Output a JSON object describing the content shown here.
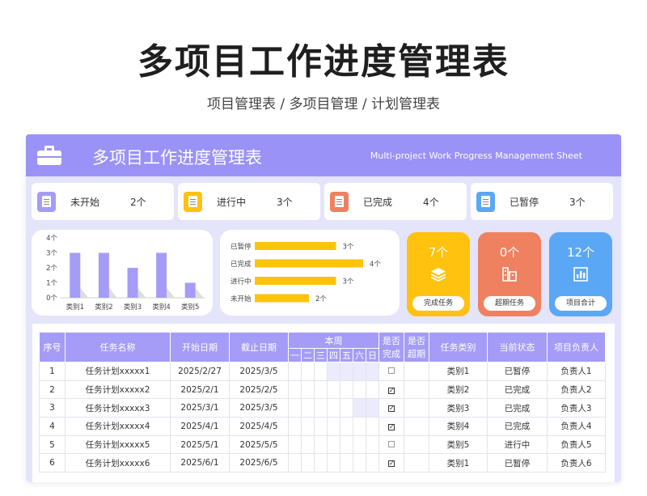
{
  "page": {
    "title": "多项目工作进度管理表",
    "subtitle": "项目管理表 / 多项目管理 / 计划管理表"
  },
  "sheet": {
    "title": "多项目工作进度管理表",
    "subtitle": "Multi-project Work Progress Management Sheet"
  },
  "stats": [
    {
      "label": "未开始",
      "count": "2个",
      "color": "#a49cf7"
    },
    {
      "label": "进行中",
      "count": "3个",
      "color": "#ffc20e"
    },
    {
      "label": "已完成",
      "count": "4个",
      "color": "#ef8160"
    },
    {
      "label": "已暂停",
      "count": "3个",
      "color": "#5aa7f5"
    }
  ],
  "chart_data": [
    {
      "type": "bar",
      "categories": [
        "类别1",
        "类别2",
        "类别3",
        "类别4",
        "类别5"
      ],
      "values": [
        3,
        3,
        2,
        3,
        1
      ],
      "ylim": [
        0,
        4
      ],
      "yticks": [
        "0个",
        "1个",
        "2个",
        "3个",
        "4个"
      ],
      "color": "#a49cf7"
    },
    {
      "type": "bar",
      "orientation": "horizontal",
      "categories": [
        "已暂停",
        "已完成",
        "进行中",
        "未开始"
      ],
      "values": [
        3,
        4,
        3,
        2
      ],
      "value_labels": [
        "3个",
        "4个",
        "3个",
        "2个"
      ],
      "color": "#ffc20e"
    }
  ],
  "kpis": [
    {
      "value": "7个",
      "label": "完成任务",
      "color": "#ffc20e",
      "icon": "layers-icon"
    },
    {
      "value": "0个",
      "label": "超期任务",
      "color": "#ef8160",
      "icon": "building-icon"
    },
    {
      "value": "12个",
      "label": "项目合计",
      "color": "#5aa7f5",
      "icon": "bar-chart-icon"
    }
  ],
  "table": {
    "headers": {
      "seq": "序号",
      "name": "任务名称",
      "start": "开始日期",
      "end": "截止日期",
      "week": "本周",
      "done": "是否完成",
      "overdue": "是否超期",
      "category": "任务类别",
      "status": "当前状态",
      "owner": "项目负责人"
    },
    "weekdays": [
      "一",
      "二",
      "三",
      "四",
      "五",
      "六",
      "日"
    ],
    "rows": [
      {
        "seq": "1",
        "name": "任务计划xxxxx1",
        "start": "2025/2/27",
        "end": "2025/3/5",
        "done": false,
        "category": "类别1",
        "status": "已暂停",
        "owner": "负责人1",
        "week": [
          0,
          0,
          0,
          1,
          1,
          1,
          1
        ]
      },
      {
        "seq": "2",
        "name": "任务计划xxxxx2",
        "start": "2025/2/1",
        "end": "2025/2/5",
        "done": true,
        "category": "类别2",
        "status": "已完成",
        "owner": "负责人2",
        "week": [
          0,
          0,
          0,
          0,
          0,
          0,
          0
        ]
      },
      {
        "seq": "3",
        "name": "任务计划xxxxx3",
        "start": "2025/3/1",
        "end": "2025/3/5",
        "done": true,
        "category": "类别3",
        "status": "已完成",
        "owner": "负责人3",
        "week": [
          0,
          0,
          0,
          0,
          0,
          1,
          1
        ]
      },
      {
        "seq": "4",
        "name": "任务计划xxxxx4",
        "start": "2025/4/1",
        "end": "2025/4/5",
        "done": true,
        "category": "类别4",
        "status": "已完成",
        "owner": "负责人4",
        "week": [
          0,
          0,
          0,
          0,
          0,
          0,
          0
        ]
      },
      {
        "seq": "5",
        "name": "任务计划xxxxx5",
        "start": "2025/5/1",
        "end": "2025/5/5",
        "done": false,
        "category": "类别5",
        "status": "进行中",
        "owner": "负责人5",
        "week": [
          0,
          0,
          0,
          0,
          0,
          0,
          0
        ]
      },
      {
        "seq": "6",
        "name": "任务计划xxxxx6",
        "start": "2025/6/1",
        "end": "2025/6/5",
        "done": true,
        "category": "类别1",
        "status": "已暂停",
        "owner": "负责人6",
        "week": [
          0,
          0,
          0,
          0,
          0,
          0,
          0
        ]
      }
    ]
  }
}
